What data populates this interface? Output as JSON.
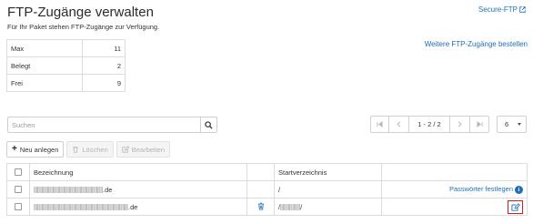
{
  "page": {
    "title": "FTP-Zugänge verwalten",
    "subtitle": "Für Ihr Paket stehen FTP-Zugänge zur Verfügung.",
    "secure_ftp_link": "Secure-FTP",
    "more_accounts_link": "Weitere FTP-Zugänge bestellen"
  },
  "stats": [
    {
      "label": "Max",
      "value": "11"
    },
    {
      "label": "Belegt",
      "value": "2"
    },
    {
      "label": "Frei",
      "value": "9"
    }
  ],
  "search": {
    "placeholder": "Suchen",
    "value": ""
  },
  "pagination": {
    "info": "1 - 2 / 2"
  },
  "per_page": {
    "value": "6"
  },
  "toolbar": {
    "new_label": "Neu anlegen",
    "delete_label": "Löschen",
    "edit_label": "Bearbeiten"
  },
  "table": {
    "headers": {
      "name": "Bezeichnung",
      "start_dir": "Startverzeichnis"
    },
    "rows": [
      {
        "name_suffix": ".de",
        "start_dir": "/",
        "action_link": "Passwörter festlegen"
      },
      {
        "name_suffix": ".de",
        "start_dir_prefix": "/",
        "start_dir_suffix": "/"
      }
    ]
  },
  "colors": {
    "link": "#1f6fb5",
    "highlight": "#d91e18",
    "border": "#dcdcdc"
  }
}
